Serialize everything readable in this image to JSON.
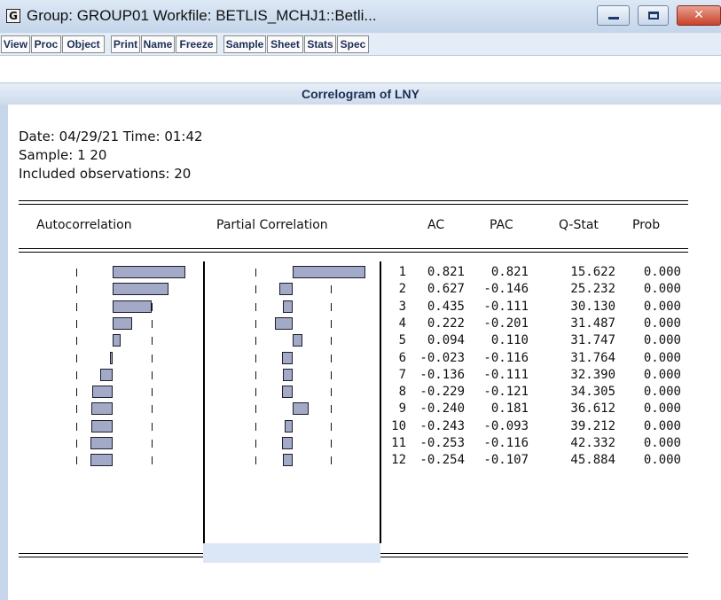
{
  "window": {
    "title": "Group: GROUP01   Workfile: BETLIS_MCHJ1::Betli...",
    "app_icon_letter": "G",
    "controls": [
      "minimize-icon",
      "maximize-icon",
      "close-icon"
    ],
    "close_glyph": "✕"
  },
  "toolbar": {
    "buttons": [
      "View",
      "Proc",
      "Object",
      "Print",
      "Name",
      "Freeze",
      "Sample",
      "Sheet",
      "Stats",
      "Spec"
    ]
  },
  "report": {
    "title": "Correlogram of LNY",
    "date_line": "Date: 04/29/21   Time: 01:42",
    "sample_line": "Sample: 1 20",
    "obs_line": "Included observations: 20"
  },
  "table": {
    "headers": {
      "autocorrelation": "Autocorrelation",
      "partial": "Partial Correlation",
      "ac": "AC",
      "pac": "PAC",
      "qstat": "Q-Stat",
      "prob": "Prob"
    },
    "rows": [
      {
        "lag": "1",
        "ac": "0.821",
        "pac": "0.821",
        "q": "15.622",
        "prob": "0.000"
      },
      {
        "lag": "2",
        "ac": "0.627",
        "pac": "-0.146",
        "q": "25.232",
        "prob": "0.000"
      },
      {
        "lag": "3",
        "ac": "0.435",
        "pac": "-0.111",
        "q": "30.130",
        "prob": "0.000"
      },
      {
        "lag": "4",
        "ac": "0.222",
        "pac": "-0.201",
        "q": "31.487",
        "prob": "0.000"
      },
      {
        "lag": "5",
        "ac": "0.094",
        "pac": "0.110",
        "q": "31.747",
        "prob": "0.000"
      },
      {
        "lag": "6",
        "ac": "-0.023",
        "pac": "-0.116",
        "q": "31.764",
        "prob": "0.000"
      },
      {
        "lag": "7",
        "ac": "-0.136",
        "pac": "-0.111",
        "q": "32.390",
        "prob": "0.000"
      },
      {
        "lag": "8",
        "ac": "-0.229",
        "pac": "-0.121",
        "q": "34.305",
        "prob": "0.000"
      },
      {
        "lag": "9",
        "ac": "-0.240",
        "pac": "0.181",
        "q": "36.612",
        "prob": "0.000"
      },
      {
        "lag": "10",
        "ac": "-0.243",
        "pac": "-0.093",
        "q": "39.212",
        "prob": "0.000"
      },
      {
        "lag": "11",
        "ac": "-0.253",
        "pac": "-0.116",
        "q": "42.332",
        "prob": "0.000"
      },
      {
        "lag": "12",
        "ac": "-0.254",
        "pac": "-0.107",
        "q": "45.884",
        "prob": "0.000"
      }
    ]
  },
  "colors": {
    "bar_fill": "#a3aac7",
    "bar_border": "#1c1c2c",
    "title_band": "#cfdbec",
    "toolbar_text": "#1c2e55"
  }
}
